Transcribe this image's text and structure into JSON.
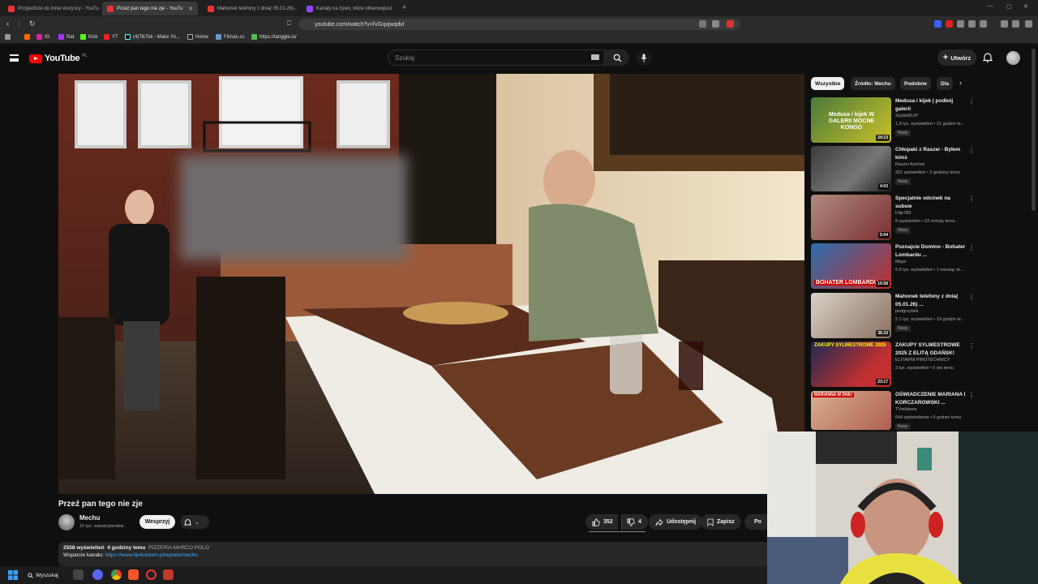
{
  "browser": {
    "tabs": [
      {
        "label": "Przyjedźcie do mnie wszyscy - YouTu",
        "active": false
      },
      {
        "label": "Przeź pan tego nie zje - YouTu",
        "active": true
      },
      {
        "label": "Mahonek telefony z dnia( 05.01.26) -",
        "active": false
      },
      {
        "label": "Kanały na żywo, które obserwujesz",
        "active": false
      }
    ],
    "url": "youtube.com/watch?v=lVGqxjwqdvI",
    "bookmarks": [
      "IG",
      "Rat",
      "Kick",
      "YT",
      "(4)TikTok - Make Yo...",
      "Home",
      "Filman.cc",
      "https://tanggle.io/"
    ]
  },
  "youtube": {
    "logo_text": "YouTube",
    "logo_country": "PL",
    "search_placeholder": "Szukaj",
    "create_label": "Utwórz"
  },
  "video": {
    "title": "Przeź pan tego nie zje",
    "channel_name": "Mechu",
    "channel_subs": "10 tys. subskrybentów",
    "support_label": "Wesprzyj",
    "likes": "352",
    "dislikes": "4",
    "share_label": "Udostępnij",
    "save_label": "Zapisz",
    "download_label": "Po",
    "views": "2558 wyświetleń",
    "posted": "4 godziny temu",
    "location": "PIZZERIA MARCO POLO",
    "support_line_label": "Wsparcie kanału:",
    "support_link": "https://www.tip4stream.pl/wplata/mechu"
  },
  "sidebar": {
    "chips": [
      "Wszystkie",
      "Źródło: Mechu",
      "Podobne",
      "Dla"
    ],
    "recommendations": [
      {
        "title": "Medusa i kijek | podbój galerii",
        "channel": "SzybkiKLIP",
        "meta": "1,9 tys. wyświetleń • 21 godzin te...",
        "badge": "Nowy",
        "duration": "24:13",
        "thumb_text": "Medusa i kijek W GALERII MOCNE KONGO"
      },
      {
        "title": "Chłopaki z Raszei - Byłem kimś",
        "channel": "Raszei Archive",
        "meta": "261 wyświetleń • 2 godziny temu",
        "badge": "Nowy",
        "duration": "4:03",
        "thumb_text": ""
      },
      {
        "title": "Specjalnie odcinek na subuw",
        "channel": "Filip789",
        "meta": "8 wyświetleń • 52 minuty temu",
        "badge": "Nowy",
        "duration": "5:04",
        "thumb_text": ""
      },
      {
        "title": "Poznajcie Domino - Bohater Lombardu ...",
        "channel": "Mayo",
        "meta": "5,9 tys. wyświetleń • 1 miesiąc te...",
        "badge": "",
        "duration": "15:58",
        "thumb_text": "BOHATER LOMBARDU"
      },
      {
        "title": "Mahonek telefony z dnia( 05.01.26) ...",
        "channel": "podgrzybek",
        "meta": "2,1 tys. wyświetleń • 19 godzin te...",
        "badge": "Nowy",
        "duration": "36:33",
        "thumb_text": ""
      },
      {
        "title": "ZAKUPY SYLWESTROWE 2025 Z ELITĄ GDAŃSK!",
        "channel": "ELITARNI PIROTECHNICY",
        "meta": "3 tys. wyświetleń • 6 dni temu",
        "badge": "",
        "duration": "23:17",
        "thumb_text": "ZAKUPY SYLWESTROWE 2025"
      },
      {
        "title": "OŚWIADCZENIE MARIANA I KORCZAROWSKI ...",
        "channel": "TVreklama",
        "meta": "644 wyświetlenia • 6 godzin temu",
        "badge": "Nowy",
        "duration": "",
        "thumb_text": "MARIANNA W DNIU"
      }
    ]
  },
  "taskbar": {
    "search_label": "Wyszukaj"
  },
  "colors": {
    "brand": "#ff0000",
    "bg": "#0f0f0f",
    "link": "#3ea6ff"
  }
}
